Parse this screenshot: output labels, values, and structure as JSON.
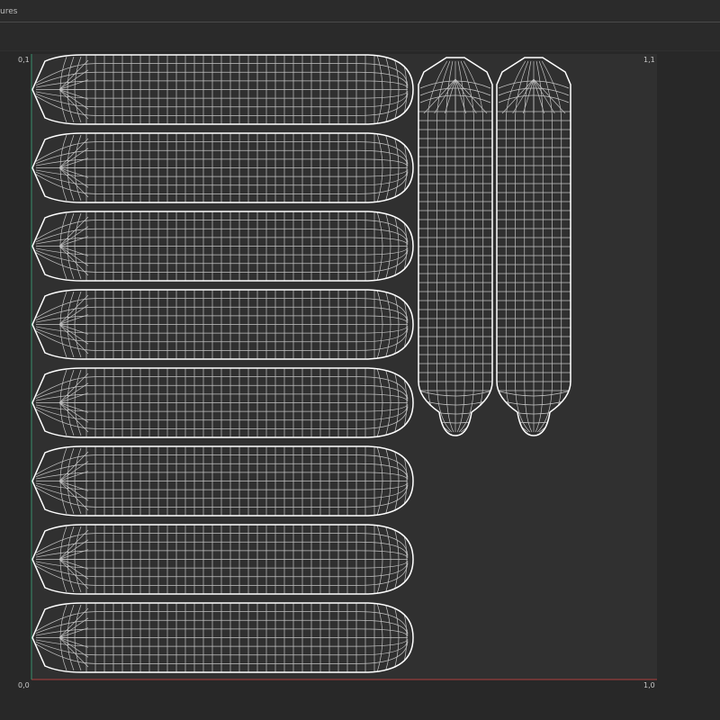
{
  "window": {
    "title": "ures"
  },
  "uv_editor": {
    "corner_labels": {
      "top_left": "0,1",
      "top_right": "1,1",
      "bottom_left": "0,0",
      "bottom_right": "1,0"
    },
    "islands": {
      "horizontal_count": 8,
      "vertical_count": 2
    },
    "colors": {
      "background": "#282828",
      "uv_area": "#303030",
      "wire": "#c4c4c4",
      "outline": "#ffffff",
      "u_axis": "#b0413e",
      "v_axis": "#3a8f6c"
    }
  }
}
